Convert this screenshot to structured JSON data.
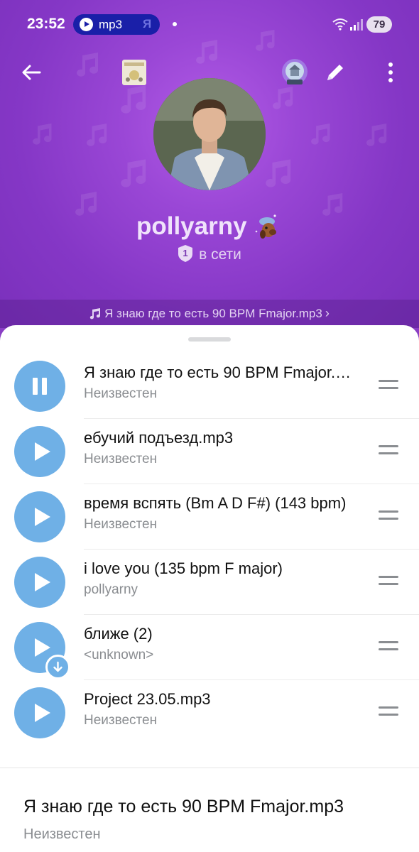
{
  "status_bar": {
    "time": "23:52",
    "media_label": "mp3",
    "media_app": "Я",
    "battery": "79"
  },
  "profile": {
    "name": "pollyarny",
    "level": "1",
    "status": "в сети"
  },
  "now_playing": {
    "text": "Я знаю где то есть 90 BPM Fmajor.mp3",
    "chevron": "›"
  },
  "tracks": [
    {
      "title": "Я знаю где то есть 90 BPM Fmajor.mp3",
      "artist": "Неизвестен",
      "state": "pause-icon"
    },
    {
      "title": "ебучий подъезд.mp3",
      "artist": "Неизвестен",
      "state": "play-icon"
    },
    {
      "title": "время вспять (Bm A D F#) (143 bpm)",
      "artist": "Неизвестен",
      "state": "play-icon"
    },
    {
      "title": "i love you (135 bpm F major)",
      "artist": "pollyarny",
      "state": "play-icon"
    },
    {
      "title": "ближе (2)",
      "artist": "<unknown>",
      "state": "play-icon",
      "download": true
    },
    {
      "title": "Project 23.05.mp3",
      "artist": "Неизвестен",
      "state": "play-icon"
    }
  ],
  "footer": {
    "title": "Я знаю где то есть 90 BPM Fmajor.mp3",
    "artist": "Неизвестен"
  },
  "colors": {
    "header_purple": "#8a3fc4",
    "play_button": "#6fb0e6",
    "status_pill": "#1a1fa8"
  }
}
